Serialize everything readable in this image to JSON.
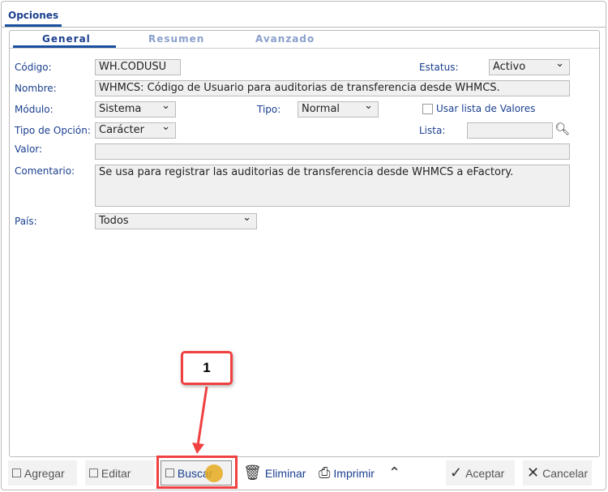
{
  "window": {
    "tab": "Opciones"
  },
  "tabs": [
    {
      "label": "General"
    },
    {
      "label": "Resumen"
    },
    {
      "label": "Avanzado"
    }
  ],
  "form": {
    "codigo": {
      "label": "Código:",
      "value": "WH.CODUSU"
    },
    "estatus": {
      "label": "Estatus:",
      "value": "Activo"
    },
    "nombre": {
      "label": "Nombre:",
      "value": "WHMCS: Código de Usuario para auditorias de transferencia desde WHMCS."
    },
    "modulo": {
      "label": "Módulo:",
      "value": "Sistema"
    },
    "tipo": {
      "label": "Tipo:",
      "value": "Normal"
    },
    "usar_lista": {
      "label": "Usar lista de Valores",
      "checked": false
    },
    "tipo_opcion": {
      "label": "Tipo de Opción:",
      "value": "Carácter"
    },
    "lista": {
      "label": "Lista:",
      "value": ""
    },
    "valor": {
      "label": "Valor:",
      "value": ""
    },
    "comentario": {
      "label": "Comentario:",
      "value": "Se usa para registrar las auditorias de transferencia desde WHMCS a eFactory."
    },
    "pais": {
      "label": "País:",
      "value": "Todos"
    }
  },
  "toolbar": {
    "agregar": "Agregar",
    "editar": "Editar",
    "buscar": "Buscar",
    "eliminar": "Eliminar",
    "imprimir": "Imprimir",
    "aceptar": "Aceptar",
    "cancelar": "Cancelar"
  },
  "callout": {
    "number": "1",
    "color": "#f04040"
  }
}
